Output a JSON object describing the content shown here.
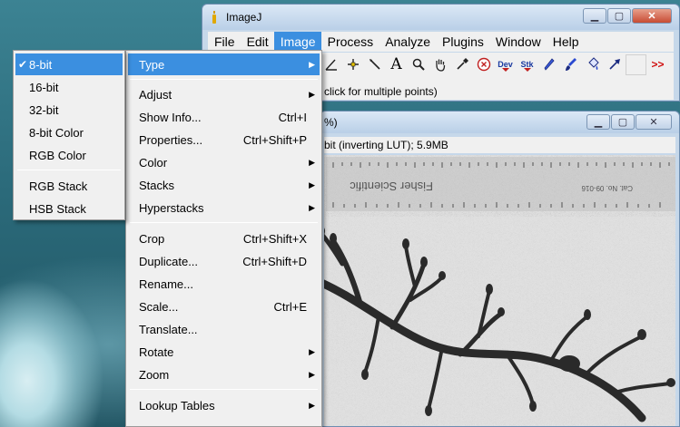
{
  "imagej_window": {
    "title": "ImageJ",
    "menu": [
      "File",
      "Edit",
      "Image",
      "Process",
      "Analyze",
      "Plugins",
      "Window",
      "Help"
    ],
    "status": "click for multiple points)",
    "tools": [
      {
        "name": "angle-tool-icon",
        "glyph": "∠"
      },
      {
        "name": "point-tool-icon",
        "glyph": "✛"
      },
      {
        "name": "wand-tool-icon",
        "glyph": "⟋"
      },
      {
        "name": "text-tool-icon",
        "glyph": "A"
      },
      {
        "name": "magnifier-tool-icon",
        "glyph": "🔍"
      },
      {
        "name": "hand-tool-icon",
        "glyph": "✋"
      },
      {
        "name": "color-picker-icon",
        "glyph": "✎"
      },
      {
        "name": "close-tool-icon",
        "glyph": "X"
      },
      {
        "name": "dev-menu-tool",
        "glyph": "Dev"
      },
      {
        "name": "stk-menu-tool",
        "glyph": "Stk"
      },
      {
        "name": "pencil-tool-icon",
        "glyph": "✏"
      },
      {
        "name": "brush-tool-icon",
        "glyph": "🖌"
      },
      {
        "name": "flood-fill-tool-icon",
        "glyph": "◈"
      },
      {
        "name": "arrow-tool-icon",
        "glyph": "➚"
      },
      {
        "name": "blank-tool",
        "glyph": ""
      },
      {
        "name": "more-tools-icon",
        "glyph": ">>"
      }
    ]
  },
  "image_window": {
    "title_suffix": "%)",
    "info": "bit (inverting LUT); 5.9MB",
    "ruler_text": "Fisher Scientific",
    "ruler_cat": "Cat. No. 09-016"
  },
  "image_menu": {
    "items": [
      {
        "label": "Type",
        "shortcut": "",
        "submenu": true,
        "highlight": true
      },
      {
        "label": "Adjust",
        "shortcut": "",
        "submenu": true
      },
      {
        "label": "Show Info...",
        "shortcut": "Ctrl+I",
        "submenu": false
      },
      {
        "label": "Properties...",
        "shortcut": "Ctrl+Shift+P",
        "submenu": false
      },
      {
        "label": "Color",
        "shortcut": "",
        "submenu": true
      },
      {
        "label": "Stacks",
        "shortcut": "",
        "submenu": true
      },
      {
        "label": "Hyperstacks",
        "shortcut": "",
        "submenu": true
      },
      {
        "label": "Crop",
        "shortcut": "Ctrl+Shift+X",
        "submenu": false
      },
      {
        "label": "Duplicate...",
        "shortcut": "Ctrl+Shift+D",
        "submenu": false
      },
      {
        "label": "Rename...",
        "shortcut": "",
        "submenu": false
      },
      {
        "label": "Scale...",
        "shortcut": "Ctrl+E",
        "submenu": false
      },
      {
        "label": "Translate...",
        "shortcut": "",
        "submenu": false
      },
      {
        "label": "Rotate",
        "shortcut": "",
        "submenu": true
      },
      {
        "label": "Zoom",
        "shortcut": "",
        "submenu": true
      },
      {
        "label": "Lookup Tables",
        "shortcut": "",
        "submenu": true
      }
    ]
  },
  "type_submenu": {
    "items": [
      {
        "label": "8-bit",
        "checked": true,
        "highlight": true
      },
      {
        "label": "16-bit",
        "checked": false
      },
      {
        "label": "32-bit",
        "checked": false
      },
      {
        "label": "8-bit Color",
        "checked": false
      },
      {
        "label": "RGB Color",
        "checked": false
      },
      {
        "label": "RGB Stack",
        "checked": false
      },
      {
        "label": "HSB Stack",
        "checked": false
      }
    ]
  },
  "colors": {
    "highlight": "#3b8fe0",
    "menu_bg": "#f0f0f0"
  }
}
